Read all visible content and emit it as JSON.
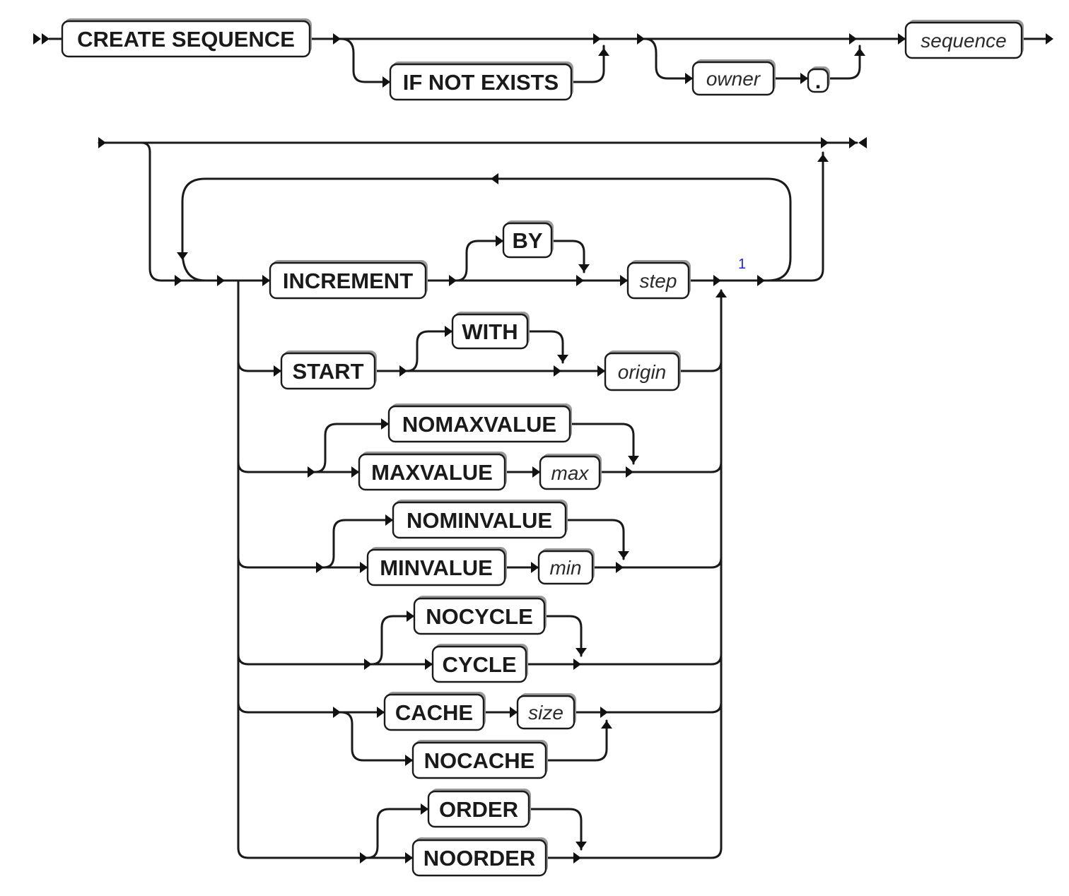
{
  "diagram": {
    "title": "CREATE SEQUENCE syntax diagram",
    "colors": {
      "line": "#1a1a1a",
      "box_border": "#1a1a1a",
      "footnote": "#2222dd"
    },
    "header": {
      "create_sequence": "CREATE SEQUENCE",
      "if_not_exists": "IF NOT EXISTS",
      "owner": "owner",
      "dot": ".",
      "sequence": "sequence"
    },
    "options": {
      "increment": "INCREMENT",
      "by": "BY",
      "step": "step",
      "footnote": "1",
      "start": "START",
      "with": "WITH",
      "origin": "origin",
      "nomaxvalue": "NOMAXVALUE",
      "maxvalue": "MAXVALUE",
      "max": "max",
      "nominvalue": "NOMINVALUE",
      "minvalue": "MINVALUE",
      "min": "min",
      "nocycle": "NOCYCLE",
      "cycle": "CYCLE",
      "cache": "CACHE",
      "size": "size",
      "nocache": "NOCACHE",
      "order": "ORDER",
      "noorder": "NOORDER"
    }
  }
}
